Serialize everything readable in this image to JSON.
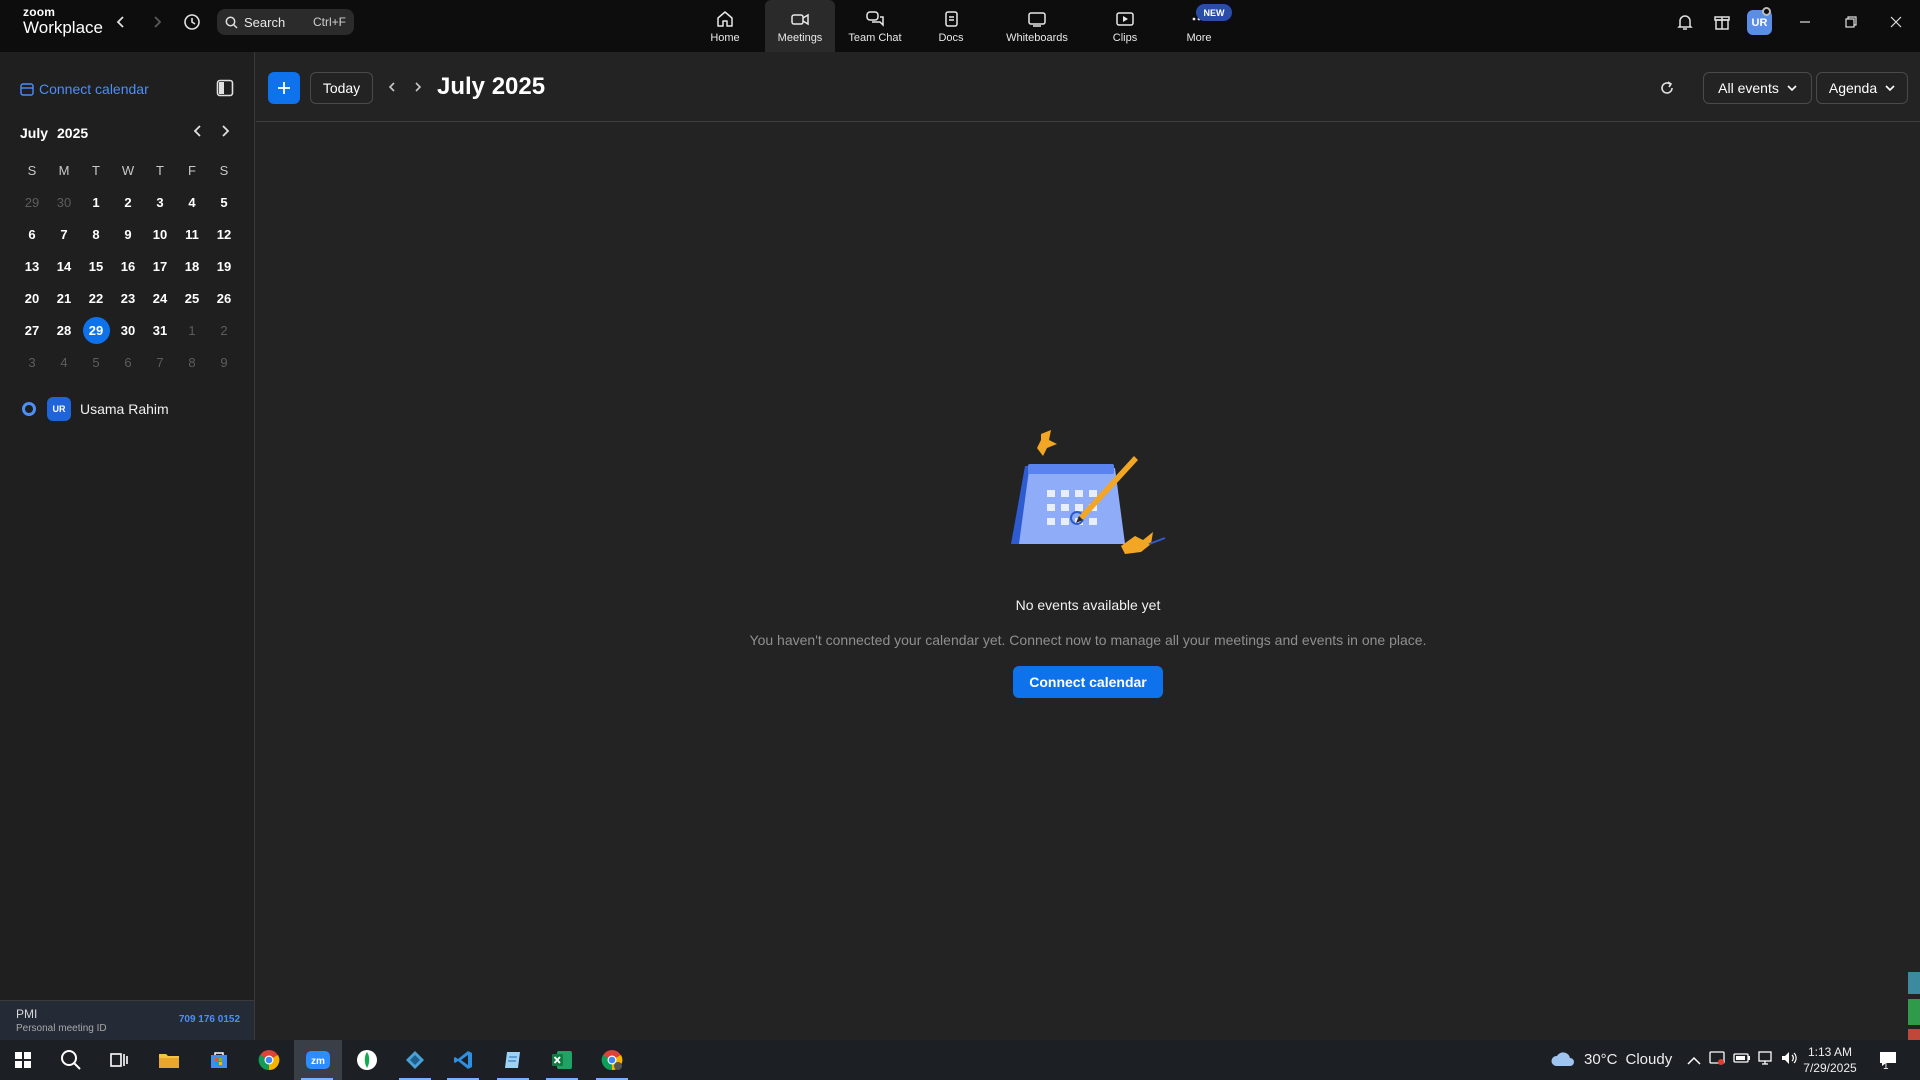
{
  "app": {
    "brand_line1": "zoom",
    "brand_line2": "Workplace"
  },
  "search": {
    "label": "Search",
    "shortcut": "Ctrl+F"
  },
  "nav": {
    "tabs": [
      {
        "label": "Home",
        "icon": "home-icon"
      },
      {
        "label": "Meetings",
        "icon": "video-icon",
        "active": true
      },
      {
        "label": "Team Chat",
        "icon": "chat-icon"
      },
      {
        "label": "Docs",
        "icon": "document-icon"
      },
      {
        "label": "Whiteboards",
        "icon": "whiteboard-icon"
      },
      {
        "label": "Clips",
        "icon": "clips-icon"
      },
      {
        "label": "More",
        "icon": "more-icon"
      }
    ],
    "new_badge": "NEW"
  },
  "profile": {
    "initials": "UR"
  },
  "sidebar": {
    "connect_calendar": "Connect calendar",
    "mini_calendar": {
      "month": "July",
      "year": "2025",
      "weekdays": [
        "S",
        "M",
        "T",
        "W",
        "T",
        "F",
        "S"
      ],
      "weeks": [
        [
          "29",
          "30",
          "1",
          "2",
          "3",
          "4",
          "5"
        ],
        [
          "6",
          "7",
          "8",
          "9",
          "10",
          "11",
          "12"
        ],
        [
          "13",
          "14",
          "15",
          "16",
          "17",
          "18",
          "19"
        ],
        [
          "20",
          "21",
          "22",
          "23",
          "24",
          "25",
          "26"
        ],
        [
          "27",
          "28",
          "29",
          "30",
          "31",
          "1",
          "2"
        ],
        [
          "3",
          "4",
          "5",
          "6",
          "7",
          "8",
          "9"
        ]
      ],
      "selected_day": "29"
    },
    "calendar_user": {
      "initials": "UR",
      "name": "Usama Rahim"
    },
    "pmi": {
      "label": "PMI",
      "sublabel": "Personal meeting ID",
      "id": "709 176 0152"
    }
  },
  "main": {
    "today_label": "Today",
    "title": "July 2025",
    "filter_label": "All events",
    "view_label": "Agenda",
    "empty_state": {
      "title": "No events available yet",
      "description": "You haven't connected your calendar yet. Connect now to manage all your meetings and events in one place.",
      "button": "Connect calendar"
    }
  },
  "colors": {
    "accent": "#0e72ed",
    "link": "#4d8ef7",
    "background": "#232323",
    "topbar": "#0d0d0d"
  },
  "taskbar": {
    "apps": [
      "windows-start-icon",
      "search-icon",
      "task-view-icon",
      "file-explorer-icon",
      "store-icon",
      "chrome-icon",
      "zoom-icon",
      "mongodb-compass-icon",
      "app-icon",
      "vscode-icon",
      "notepad-icon",
      "excel-icon",
      "chrome-profile-icon"
    ],
    "weather": {
      "temp": "30°C",
      "condition": "Cloudy"
    },
    "time": "1:13 AM",
    "date": "7/29/2025",
    "notifications": "1"
  }
}
